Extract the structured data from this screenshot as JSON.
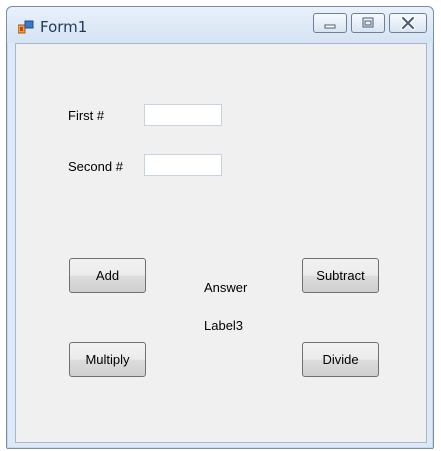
{
  "window": {
    "title": "Form1"
  },
  "form": {
    "first_label": "First #",
    "first_value": "",
    "second_label": "Second #",
    "second_value": "",
    "answer_label": "Answer",
    "result_label": "Label3"
  },
  "buttons": {
    "add": "Add",
    "subtract": "Subtract",
    "multiply": "Multiply",
    "divide": "Divide"
  },
  "colors": {
    "titlebar": "#dde9f6",
    "client_background": "#f0f0f0",
    "title_text": "#1e395b"
  }
}
